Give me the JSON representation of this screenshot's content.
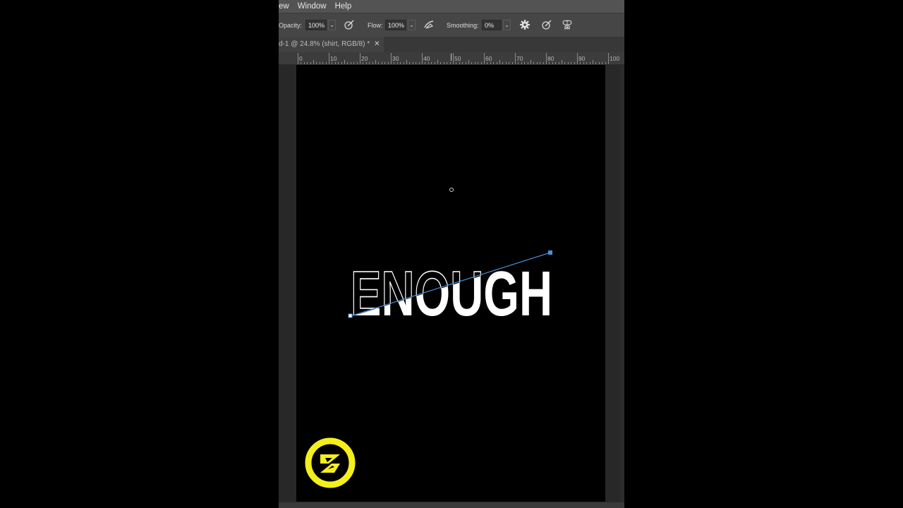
{
  "menu": {
    "items": [
      "ew",
      "Window",
      "Help"
    ]
  },
  "options_bar": {
    "opacity_label": "Opacity:",
    "opacity_value": "100%",
    "flow_label": "Flow:",
    "flow_value": "100%",
    "smoothing_label": "Smoothing:",
    "smoothing_value": "0%",
    "icons": [
      "pressure-opacity-icon",
      "airbrush-icon",
      "gear-icon",
      "pressure-size-icon",
      "symmetry-icon"
    ]
  },
  "document_tab": {
    "title": "d-1 @ 24.8% (shirt, RGB/8) *",
    "close": "✕"
  },
  "ruler": {
    "labels": [
      "0",
      "10",
      "20",
      "30",
      "40",
      "50",
      "60",
      "70",
      "80",
      "90",
      "100"
    ]
  },
  "canvas": {
    "headline": "ENOUGH",
    "colors": {
      "background": "#000000",
      "text": "#ffffff",
      "path_line": "#4a90d9",
      "logo": "#f4ef1b"
    }
  }
}
